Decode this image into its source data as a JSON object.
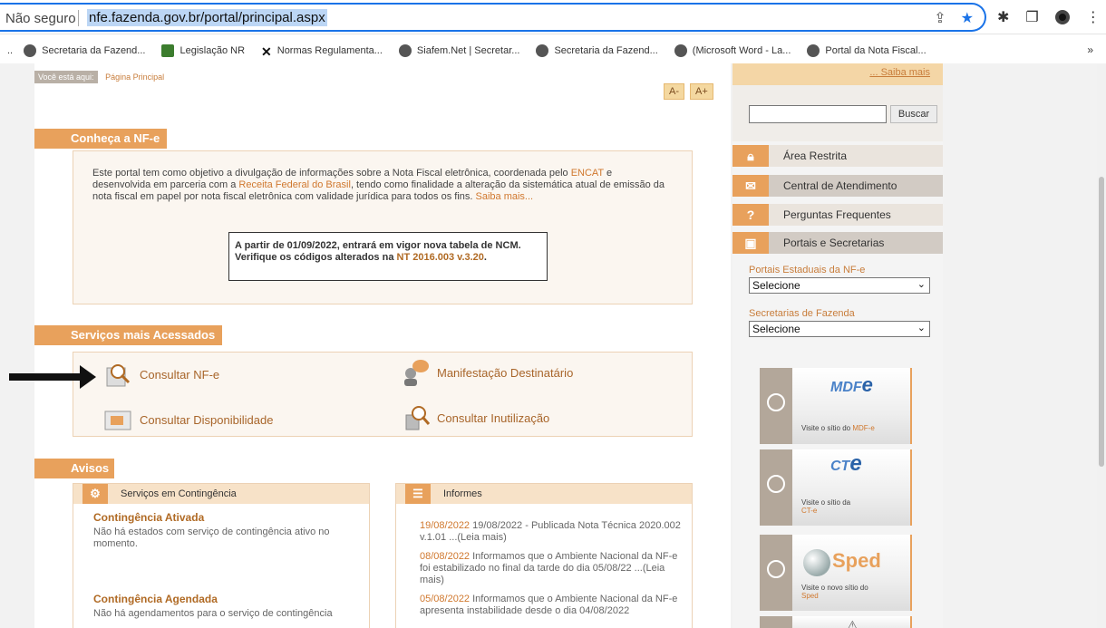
{
  "browser": {
    "insecure_label": "Não seguro",
    "url": "nfe.fazenda.gov.br/portal/principal.aspx",
    "bookmarks": [
      "Secretaria da Fazend...",
      "Legislação NR",
      "Normas Regulamenta...",
      "Siafem.Net | Secretar...",
      "Secretaria da Fazend...",
      "(Microsoft Word - La...",
      "Portal da Nota Fiscal..."
    ],
    "bookmarks_leading": "..",
    "bookmarks_more": "»"
  },
  "breadcrumb": {
    "label": "Você está aqui:",
    "current": "Página Principal"
  },
  "font_buttons": {
    "smaller": "A-",
    "larger": "A+"
  },
  "conheca": {
    "heading": "Conheça a NF-e",
    "intro_1": "Este portal tem como objetivo a divulgação de informações sobre a Nota Fiscal eletrônica, coordenada pelo ",
    "intro_link_encat": "ENCAT",
    "intro_2": " e desenvolvida em parceria com a ",
    "intro_link_rfb": "Receita Federal do Brasil",
    "intro_3": ", tendo como finalidade a alteração da sistemática atual de emissão da nota fiscal em papel por nota fiscal eletrônica com validade jurídica para todos os fins. ",
    "intro_link_saiba": "Saiba mais...",
    "notice_line1": "A partir de 01/09/2022, entrará em vigor nova tabela de NCM.",
    "notice_line2": "Verifique os códigos alterados na ",
    "notice_link": "NT 2016.003 v.3.20",
    "notice_end": "."
  },
  "servicos": {
    "heading": "Serviços mais Acessados",
    "items": [
      "Consultar NF-e",
      "Manifestação Destinatário",
      "Consultar Disponibilidade",
      "Consultar Inutilização"
    ]
  },
  "avisos": {
    "heading": "Avisos",
    "contingencia": {
      "title": "Serviços em Contingência",
      "ativada_title": "Contingência Ativada",
      "ativada_text": "Não há estados com serviço de contingência ativo no momento.",
      "agendada_title": "Contingência Agendada",
      "agendada_text": "Não há agendamentos para o serviço de contingência"
    },
    "informes": {
      "title": "Informes",
      "items": [
        {
          "date": "19/08/2022",
          "text": " 19/08/2022 - Publicada Nota Técnica 2020.002 v.1.01 ...(Leia mais)"
        },
        {
          "date": "08/08/2022",
          "text": " Informamos que o Ambiente Nacional da NF-e foi estabilizado no final da tarde do dia 05/08/22 ...(Leia mais)"
        },
        {
          "date": "05/08/2022",
          "text": " Informamos que o Ambiente Nacional da NF-e apresenta instabilidade desde o dia 04/08/2022"
        }
      ]
    }
  },
  "sidebar": {
    "saiba_mais": "... Saiba mais",
    "search_button": "Buscar",
    "menu": [
      "Área Restrita",
      "Central de Atendimento",
      "Perguntas Frequentes",
      "Portais e Secretarias"
    ],
    "portais_label": "Portais Estaduais da NF-e",
    "portais_value": "Selecione",
    "secretarias_label": "Secretarias de Fazenda",
    "secretarias_value": "Selecione",
    "banners": [
      {
        "logo": "MDF",
        "logo_sub": "e",
        "text": "Visite o sítio do ",
        "text_hl": "MDF-e"
      },
      {
        "logo": "CT",
        "logo_sub": "e",
        "text": "Visite o sítio da ",
        "text_hl": "CT-e"
      },
      {
        "logo": "Sped",
        "text": "Visite o novo sítio do ",
        "text_hl": "Sped"
      }
    ]
  },
  "colors": {
    "accent": "#e8a15c",
    "link": "#d0782e",
    "omnibox": "#1a73e8"
  }
}
